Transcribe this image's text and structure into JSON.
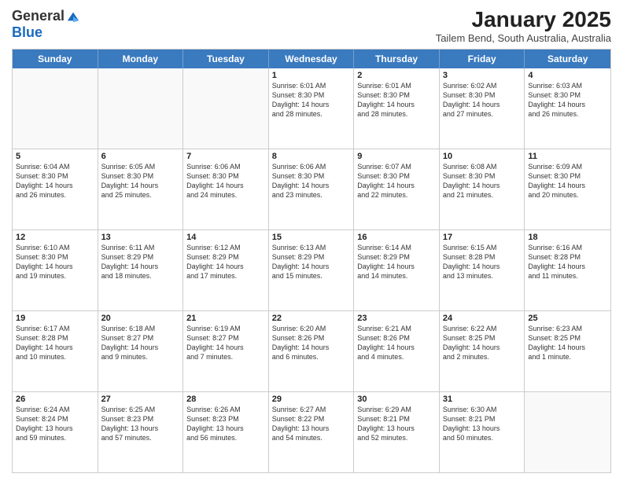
{
  "header": {
    "logo_general": "General",
    "logo_blue": "Blue",
    "month_title": "January 2025",
    "location": "Tailem Bend, South Australia, Australia"
  },
  "weekdays": [
    "Sunday",
    "Monday",
    "Tuesday",
    "Wednesday",
    "Thursday",
    "Friday",
    "Saturday"
  ],
  "rows": [
    [
      {
        "day": "",
        "text": ""
      },
      {
        "day": "",
        "text": ""
      },
      {
        "day": "",
        "text": ""
      },
      {
        "day": "1",
        "text": "Sunrise: 6:01 AM\nSunset: 8:30 PM\nDaylight: 14 hours\nand 28 minutes."
      },
      {
        "day": "2",
        "text": "Sunrise: 6:01 AM\nSunset: 8:30 PM\nDaylight: 14 hours\nand 28 minutes."
      },
      {
        "day": "3",
        "text": "Sunrise: 6:02 AM\nSunset: 8:30 PM\nDaylight: 14 hours\nand 27 minutes."
      },
      {
        "day": "4",
        "text": "Sunrise: 6:03 AM\nSunset: 8:30 PM\nDaylight: 14 hours\nand 26 minutes."
      }
    ],
    [
      {
        "day": "5",
        "text": "Sunrise: 6:04 AM\nSunset: 8:30 PM\nDaylight: 14 hours\nand 26 minutes."
      },
      {
        "day": "6",
        "text": "Sunrise: 6:05 AM\nSunset: 8:30 PM\nDaylight: 14 hours\nand 25 minutes."
      },
      {
        "day": "7",
        "text": "Sunrise: 6:06 AM\nSunset: 8:30 PM\nDaylight: 14 hours\nand 24 minutes."
      },
      {
        "day": "8",
        "text": "Sunrise: 6:06 AM\nSunset: 8:30 PM\nDaylight: 14 hours\nand 23 minutes."
      },
      {
        "day": "9",
        "text": "Sunrise: 6:07 AM\nSunset: 8:30 PM\nDaylight: 14 hours\nand 22 minutes."
      },
      {
        "day": "10",
        "text": "Sunrise: 6:08 AM\nSunset: 8:30 PM\nDaylight: 14 hours\nand 21 minutes."
      },
      {
        "day": "11",
        "text": "Sunrise: 6:09 AM\nSunset: 8:30 PM\nDaylight: 14 hours\nand 20 minutes."
      }
    ],
    [
      {
        "day": "12",
        "text": "Sunrise: 6:10 AM\nSunset: 8:30 PM\nDaylight: 14 hours\nand 19 minutes."
      },
      {
        "day": "13",
        "text": "Sunrise: 6:11 AM\nSunset: 8:29 PM\nDaylight: 14 hours\nand 18 minutes."
      },
      {
        "day": "14",
        "text": "Sunrise: 6:12 AM\nSunset: 8:29 PM\nDaylight: 14 hours\nand 17 minutes."
      },
      {
        "day": "15",
        "text": "Sunrise: 6:13 AM\nSunset: 8:29 PM\nDaylight: 14 hours\nand 15 minutes."
      },
      {
        "day": "16",
        "text": "Sunrise: 6:14 AM\nSunset: 8:29 PM\nDaylight: 14 hours\nand 14 minutes."
      },
      {
        "day": "17",
        "text": "Sunrise: 6:15 AM\nSunset: 8:28 PM\nDaylight: 14 hours\nand 13 minutes."
      },
      {
        "day": "18",
        "text": "Sunrise: 6:16 AM\nSunset: 8:28 PM\nDaylight: 14 hours\nand 11 minutes."
      }
    ],
    [
      {
        "day": "19",
        "text": "Sunrise: 6:17 AM\nSunset: 8:28 PM\nDaylight: 14 hours\nand 10 minutes."
      },
      {
        "day": "20",
        "text": "Sunrise: 6:18 AM\nSunset: 8:27 PM\nDaylight: 14 hours\nand 9 minutes."
      },
      {
        "day": "21",
        "text": "Sunrise: 6:19 AM\nSunset: 8:27 PM\nDaylight: 14 hours\nand 7 minutes."
      },
      {
        "day": "22",
        "text": "Sunrise: 6:20 AM\nSunset: 8:26 PM\nDaylight: 14 hours\nand 6 minutes."
      },
      {
        "day": "23",
        "text": "Sunrise: 6:21 AM\nSunset: 8:26 PM\nDaylight: 14 hours\nand 4 minutes."
      },
      {
        "day": "24",
        "text": "Sunrise: 6:22 AM\nSunset: 8:25 PM\nDaylight: 14 hours\nand 2 minutes."
      },
      {
        "day": "25",
        "text": "Sunrise: 6:23 AM\nSunset: 8:25 PM\nDaylight: 14 hours\nand 1 minute."
      }
    ],
    [
      {
        "day": "26",
        "text": "Sunrise: 6:24 AM\nSunset: 8:24 PM\nDaylight: 13 hours\nand 59 minutes."
      },
      {
        "day": "27",
        "text": "Sunrise: 6:25 AM\nSunset: 8:23 PM\nDaylight: 13 hours\nand 57 minutes."
      },
      {
        "day": "28",
        "text": "Sunrise: 6:26 AM\nSunset: 8:23 PM\nDaylight: 13 hours\nand 56 minutes."
      },
      {
        "day": "29",
        "text": "Sunrise: 6:27 AM\nSunset: 8:22 PM\nDaylight: 13 hours\nand 54 minutes."
      },
      {
        "day": "30",
        "text": "Sunrise: 6:29 AM\nSunset: 8:21 PM\nDaylight: 13 hours\nand 52 minutes."
      },
      {
        "day": "31",
        "text": "Sunrise: 6:30 AM\nSunset: 8:21 PM\nDaylight: 13 hours\nand 50 minutes."
      },
      {
        "day": "",
        "text": ""
      }
    ]
  ]
}
